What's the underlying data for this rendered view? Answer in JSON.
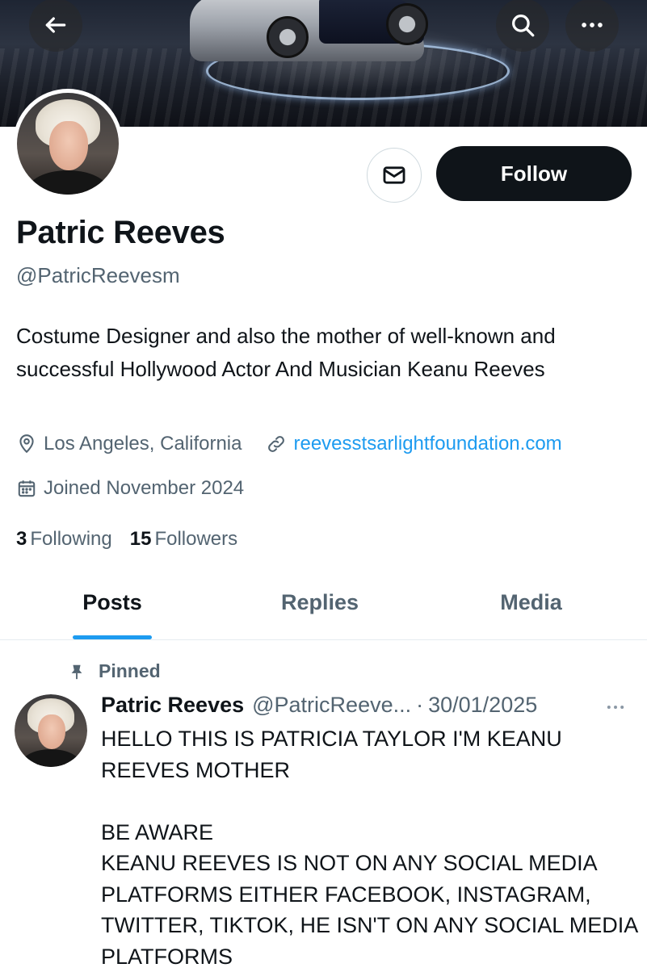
{
  "header": {
    "back_icon": "arrow-left-icon",
    "search_icon": "search-icon",
    "more_icon": "more-horizontal-icon"
  },
  "profile": {
    "name": "Patric Reeves",
    "handle": "@PatricReevesm",
    "bio": "Costume Designer and also the mother of well-known and successful Hollywood Actor And Musician Keanu Reeves",
    "location": "Los Angeles, California",
    "website": "reevesstsarlightfoundation.com",
    "joined": "Joined November 2024",
    "following_count": "3",
    "following_label": "Following",
    "followers_count": "15",
    "followers_label": "Followers",
    "follow_label": "Follow"
  },
  "tabs": [
    {
      "label": "Posts",
      "active": true
    },
    {
      "label": "Replies",
      "active": false
    },
    {
      "label": "Media",
      "active": false
    }
  ],
  "post": {
    "pinned_label": "Pinned",
    "author_name": "Patric Reeves",
    "author_handle": "@PatricReeve...",
    "separator": "·",
    "date": "30/01/2025",
    "text": "HELLO THIS IS PATRICIA TAYLOR I'M KEANU REEVES MOTHER\n\nBE AWARE\nKEANU REEVES IS NOT ON ANY SOCIAL MEDIA PLATFORMS EITHER FACEBOOK, INSTAGRAM, TWITTER, TIKTOK, HE ISN'T ON ANY SOCIAL MEDIA PLATFORMS"
  },
  "colors": {
    "accent": "#1d9bf0",
    "text": "#0f1419",
    "secondary": "#536471"
  }
}
